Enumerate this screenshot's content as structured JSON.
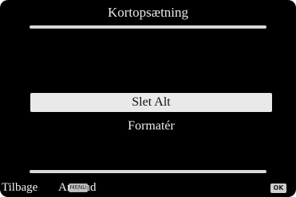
{
  "screen": {
    "title": "Kortopsætning"
  },
  "menu": {
    "items": [
      {
        "label": "Slet Alt",
        "selected": true
      },
      {
        "label": "Formatér",
        "selected": false
      }
    ]
  },
  "footer": {
    "back_label": "Tilbage",
    "apply_label": "Anvend",
    "menu_icon_text": "MENU",
    "ok_icon_text": "OK"
  },
  "icons": {
    "back": "menu-button-icon",
    "apply": "ok-button-icon"
  },
  "colors": {
    "background": "#000000",
    "text": "#f0f0f0",
    "selection": "#e9e9e9"
  }
}
